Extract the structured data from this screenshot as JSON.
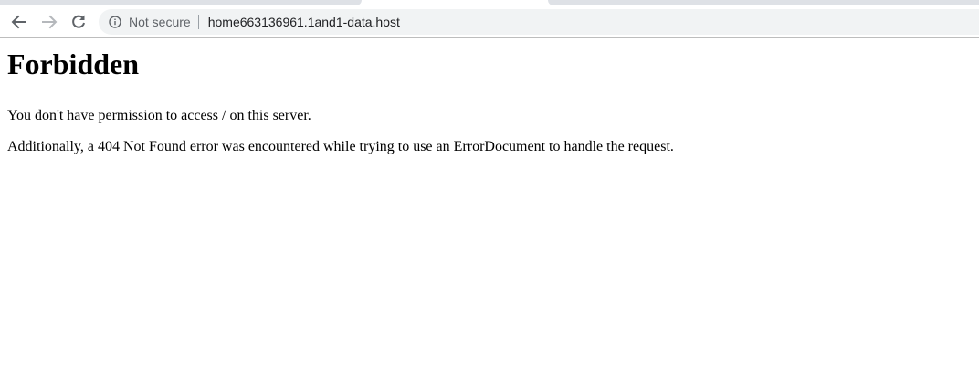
{
  "browser": {
    "security_label": "Not secure",
    "url": "home663136961.1and1-data.host",
    "icons": {
      "back": "back-arrow-icon",
      "forward": "forward-arrow-icon",
      "reload": "reload-icon",
      "info": "info-icon"
    }
  },
  "page": {
    "heading": "Forbidden",
    "paragraph1": "You don't have permission to access / on this server.",
    "paragraph2": "Additionally, a 404 Not Found error was encountered while trying to use an ErrorDocument to handle the request."
  }
}
